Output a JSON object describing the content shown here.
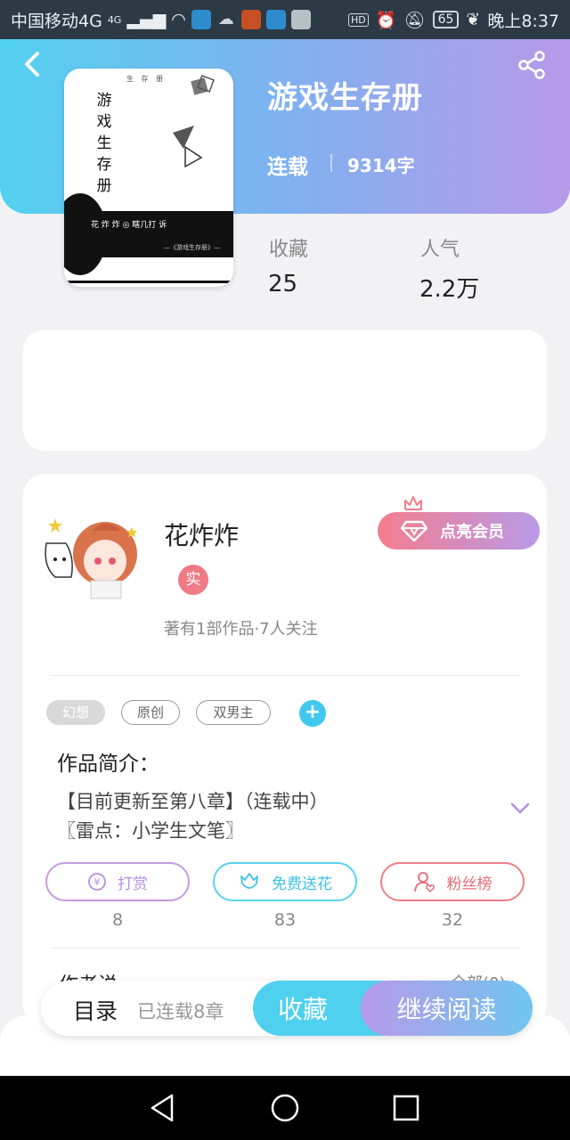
{
  "status_bar": {
    "carrier": "中国移动4G",
    "signal": "4G",
    "battery": "65",
    "hd": "HD",
    "time": "晚上8:37"
  },
  "book": {
    "title": "游戏生存册",
    "status": "连载",
    "word_count": "9314字",
    "cover": {
      "vertical_title": "游戏生存册",
      "top_note": "生 存 册",
      "band_text": "花 炸 炸 ◎ 瞎几打 诉",
      "band_subtext": "—《游戏生存册》—"
    }
  },
  "stats": {
    "favorites_label": "收藏",
    "favorites_value": "25",
    "popularity_label": "人气",
    "popularity_value": "2.2万"
  },
  "author": {
    "name": "花炸炸",
    "badge": "实",
    "meta": "著有1部作品·7人关注",
    "member_button": "点亮会员"
  },
  "tags": [
    "幻想",
    "原创",
    "双男主"
  ],
  "tag_add": "+",
  "intro": {
    "title": "作品简介：",
    "lines": [
      "【目前更新至第八章】（连载中）",
      "〖雷点：小学生文笔〗"
    ]
  },
  "actions": [
    {
      "label": "打赏",
      "count": "8"
    },
    {
      "label": "免费送花",
      "count": "83"
    },
    {
      "label": "粉丝榜",
      "count": "32"
    }
  ],
  "peek": {
    "left": "作者说",
    "right": "全部(0) ›"
  },
  "bottom": {
    "toc_label": "目录",
    "toc_sub": "已连载8章",
    "collect": "收藏",
    "read": "继续阅读"
  },
  "colors": {
    "header_gradient_start": "#53d1f0",
    "header_gradient_end": "#b79ae9",
    "accent_cyan": "#4fd0ef",
    "accent_purple": "#b79ae9",
    "accent_pink": "#ef7b86"
  }
}
